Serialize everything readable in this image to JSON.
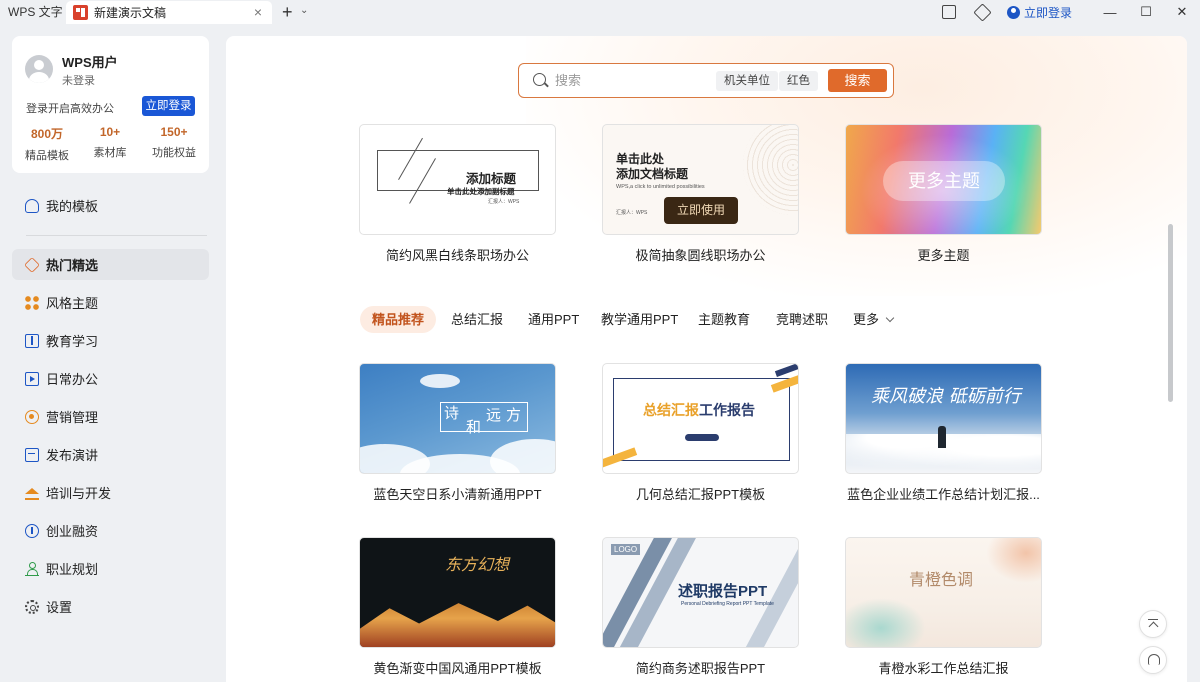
{
  "titlebar": {
    "app_name": "WPS 文字",
    "tab_title": "新建演示文稿",
    "close": "×",
    "add": "+",
    "add_caret": "⌄",
    "login_label": "立即登录",
    "minimize": "—",
    "maximize": "☐",
    "close_window": "✕"
  },
  "user_card": {
    "name": "WPS用户",
    "status": "未登录",
    "hint": "登录开启高效办公",
    "login_button": "立即登录",
    "stats": [
      {
        "value": "800万",
        "label": "精品模板"
      },
      {
        "value": "10+",
        "label": "素材库"
      },
      {
        "value": "150+",
        "label": "功能权益"
      }
    ]
  },
  "nav": {
    "my_templates": "我的模板",
    "items": [
      {
        "label": "热门精选",
        "icon": "heart-icon",
        "active": true
      },
      {
        "label": "风格主题",
        "icon": "grid-icon"
      },
      {
        "label": "教育学习",
        "icon": "book-icon"
      },
      {
        "label": "日常办公",
        "icon": "screen-icon"
      },
      {
        "label": "营销管理",
        "icon": "target-icon"
      },
      {
        "label": "发布演讲",
        "icon": "chat-icon"
      },
      {
        "label": "培训与开发",
        "icon": "cap-icon"
      },
      {
        "label": "创业融资",
        "icon": "coin-icon"
      },
      {
        "label": "职业规划",
        "icon": "person-icon"
      },
      {
        "label": "设置",
        "icon": "gear-icon"
      }
    ]
  },
  "search": {
    "placeholder": "搜索",
    "tags": [
      "机关单位",
      "红色"
    ],
    "button": "搜索"
  },
  "themes": [
    {
      "caption": "简约风黑白线条职场办公",
      "thumb_title": "添加标题",
      "thumb_subtitle": "单击此处添加副标题",
      "thumb_reporter": "汇报人：WPS"
    },
    {
      "caption": "极简抽象圆线职场办公",
      "thumb_title_1": "单击此处",
      "thumb_title_2": "添加文档标题",
      "thumb_subtitle": "WPS,a click to unlimited possibilities",
      "thumb_reporter": "汇报人：WPS",
      "use_button": "立即使用"
    },
    {
      "caption": "更多主题",
      "thumb_label": "更多主题"
    }
  ],
  "category_tabs": [
    "精品推荐",
    "总结汇报",
    "通用PPT",
    "教学通用PPT",
    "主题教育",
    "竞聘述职",
    "更多"
  ],
  "templates": [
    {
      "caption": "蓝色天空日系小清新通用PPT",
      "thumb_text": [
        "诗",
        "和",
        "远",
        "方"
      ]
    },
    {
      "caption": "几何总结汇报PPT模板",
      "thumb_title_a": "总结汇报",
      "thumb_title_b": "工作报告"
    },
    {
      "caption": "蓝色企业业绩工作总结计划汇报...",
      "thumb_title": "乘风破浪 砥砺前行"
    },
    {
      "caption": "黄色渐变中国风通用PPT模板",
      "thumb_title": "东方幻想"
    },
    {
      "caption": "简约商务述职报告PPT",
      "thumb_logo": "LOGO",
      "thumb_title": "述职报告PPT",
      "thumb_subtitle": "Personal Debriefing Report PPT Template"
    },
    {
      "caption": "青橙水彩工作总结汇报",
      "thumb_title": "青橙色调"
    }
  ],
  "colors": {
    "accent": "#e06a2b",
    "brand_blue": "#1a57d6",
    "stat_orange": "#c2662a"
  }
}
